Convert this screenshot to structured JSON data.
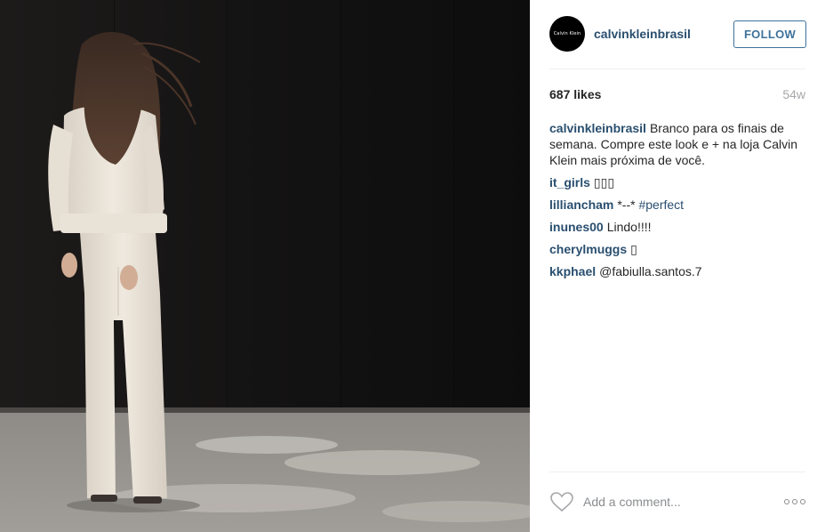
{
  "post": {
    "account": {
      "avatar_text": "Calvin Klein",
      "username": "calvinkleinbrasil",
      "follow_label": "FOLLOW"
    },
    "likes": "687 likes",
    "age": "54w",
    "caption": {
      "author": "calvinkleinbrasil",
      "text": "Branco para os finais de semana. Compre este look e + na loja Calvin Klein mais próxima de você."
    },
    "comments": [
      {
        "author": "it_girls",
        "text": "▯▯▯"
      },
      {
        "author": "lilliancham",
        "text": "*--*",
        "hashtag": "#perfect"
      },
      {
        "author": "inunes00",
        "text": "Lindo!!!!"
      },
      {
        "author": "cherylmuggs",
        "text": "▯"
      },
      {
        "author": "kkphael",
        "text": "@fabiulla.santos.7"
      }
    ],
    "add_comment_placeholder": "Add a comment...",
    "icons": {
      "like": "heart-outline-icon",
      "more": "more-options-icon"
    },
    "colors": {
      "link": "#2a4f6f",
      "follow": "#3f729b",
      "muted": "#a5a7aa"
    }
  }
}
